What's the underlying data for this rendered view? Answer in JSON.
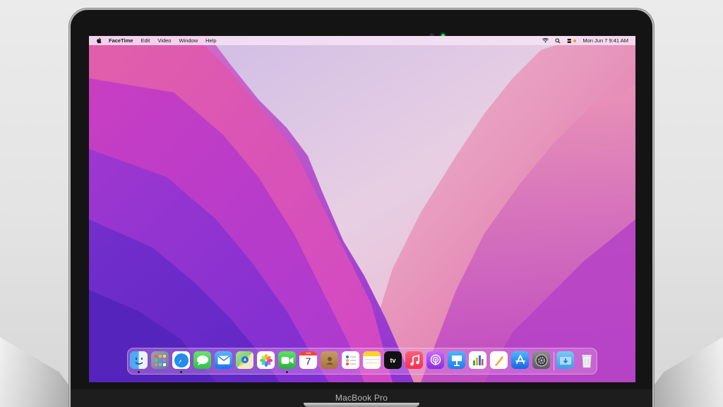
{
  "device": {
    "model_label": "MacBook Pro"
  },
  "menubar": {
    "app_name": "FaceTime",
    "menus": [
      "Edit",
      "Video",
      "Window",
      "Help"
    ],
    "clock": "Mon Jun 7  9:41 AM"
  },
  "dock": {
    "apps": [
      {
        "name": "Finder",
        "icon": "finder-icon",
        "running": true
      },
      {
        "name": "Launchpad",
        "icon": "launchpad-icon",
        "running": false
      },
      {
        "name": "Safari",
        "icon": "safari-icon",
        "running": true
      },
      {
        "name": "Messages",
        "icon": "messages-icon",
        "running": false
      },
      {
        "name": "Mail",
        "icon": "mail-icon",
        "running": false
      },
      {
        "name": "Maps",
        "icon": "maps-icon",
        "running": false
      },
      {
        "name": "Photos",
        "icon": "photos-icon",
        "running": false
      },
      {
        "name": "FaceTime",
        "icon": "facetime-icon",
        "running": true
      },
      {
        "name": "Calendar",
        "icon": "calendar-icon",
        "running": false,
        "month": "JUN",
        "day": "7"
      },
      {
        "name": "Contacts",
        "icon": "contacts-icon",
        "running": false
      },
      {
        "name": "Reminders",
        "icon": "reminders-icon",
        "running": false
      },
      {
        "name": "Notes",
        "icon": "notes-icon",
        "running": false
      },
      {
        "name": "TV",
        "icon": "tv-icon",
        "running": false,
        "label": "tv"
      },
      {
        "name": "Music",
        "icon": "music-icon",
        "running": false
      },
      {
        "name": "Podcasts",
        "icon": "podcasts-icon",
        "running": false
      },
      {
        "name": "Keynote",
        "icon": "keynote-icon",
        "running": false
      },
      {
        "name": "Numbers",
        "icon": "numbers-icon",
        "running": false
      },
      {
        "name": "Pages",
        "icon": "pages-icon",
        "running": false
      },
      {
        "name": "App Store",
        "icon": "app-store-icon",
        "running": false
      },
      {
        "name": "System Preferences",
        "icon": "system-preferences-icon",
        "running": false
      }
    ],
    "extras": [
      {
        "name": "Downloads",
        "icon": "downloads-folder-icon"
      },
      {
        "name": "Trash",
        "icon": "trash-icon"
      }
    ]
  },
  "colors": {
    "camera_indicator": "#28e05a",
    "wallpaper_magenta": "#c23dcf",
    "wallpaper_violet": "#5a22c8",
    "wallpaper_pink": "#e06aa0"
  }
}
